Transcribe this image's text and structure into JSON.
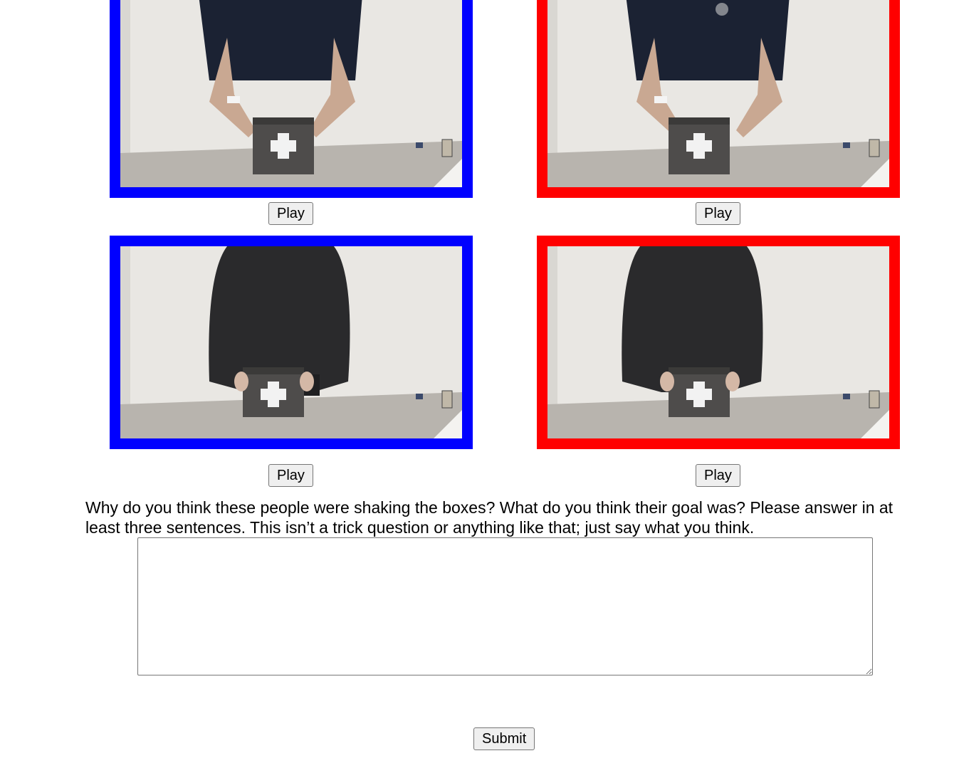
{
  "videos": [
    {
      "frame_color": "blue",
      "scene": "person-navy-shirt-holding-box",
      "play_label": "Play"
    },
    {
      "frame_color": "red",
      "scene": "person-navy-shirt-holding-box",
      "play_label": "Play"
    },
    {
      "frame_color": "blue",
      "scene": "person-dark-sweatshirt-holding-box",
      "play_label": "Play"
    },
    {
      "frame_color": "red",
      "scene": "person-dark-sweatshirt-holding-box",
      "play_label": "Play"
    }
  ],
  "question": {
    "text": "Why do you think these people were shaking the boxes? What do you think their goal was? Please answer in at least three sentences. This isn’t a trick question or anything like that; just say what you think."
  },
  "answer": {
    "value": "",
    "placeholder": ""
  },
  "submit_label": "Submit",
  "colors": {
    "blue_frame": "#0000ff",
    "red_frame": "#ff0000"
  }
}
